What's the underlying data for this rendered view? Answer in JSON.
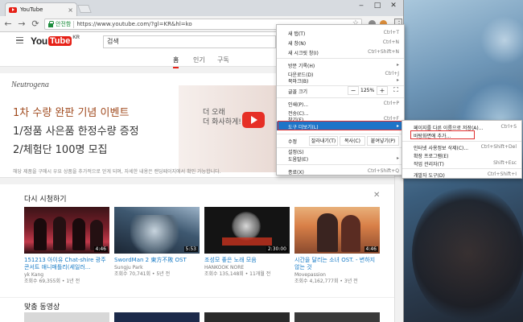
{
  "tab": {
    "title": "YouTube",
    "close": "×"
  },
  "window": {
    "minimize": "‒",
    "restore": "□",
    "close": "✕"
  },
  "toolbar": {
    "back": "←",
    "forward": "→",
    "reload": "⟳",
    "secure_label": "안전함",
    "url": "https://www.youtube.com/?gl=KR&hl=ko",
    "star": "☆",
    "menu": "⋮"
  },
  "yt": {
    "logo_you": "You",
    "logo_tube": "Tube",
    "logo_region": "KR",
    "search_text": "검색",
    "nav_tabs": [
      "홈",
      "인기",
      "구독"
    ]
  },
  "banner": {
    "brand": "Neutrogena",
    "line1": "1차 수량 완판 기념 이벤트",
    "line2": "1/정품 사은품 한정수량 증정",
    "line3": "2/체험단 100명 모집",
    "tag1": "더 오래",
    "tag2": "더 화사하게!",
    "disclaimer": "해당 제품을 구매시 우요 상품을 추가적으로 얻게 되며, 자세한 내용은 랜딩페이지에서 확인 가능합니다."
  },
  "shelf": {
    "title": "다시 시청하기",
    "close": "✕",
    "videos": [
      {
        "duration": "4:46",
        "title": "151213 아이유 Chat-shire 광주콘서트 애니매틀리(세일러...",
        "channel": "yk Kang",
        "meta": "조회수 69,355회 • 1년 전"
      },
      {
        "duration": "5:53",
        "title": "SwordMan 2 東方不敗 OST",
        "channel": "Sungju Park",
        "meta": "조회수 70,741회 • 5년 전"
      },
      {
        "duration": "2:30:00",
        "title": "조성모 좋은 노래 모음",
        "channel": "HANKOOK NORE",
        "meta": "조회수 135,148회 • 11개월 전"
      },
      {
        "duration": "4:46",
        "title": "시간을 달리는 소녀 OST. - 변하지 않는 것",
        "channel": "Movepassion",
        "meta": "조회수 4,162,777회 • 3년 전"
      }
    ]
  },
  "next_shelf": {
    "title": "맞춤 동영상"
  },
  "chrome_menu": {
    "items": [
      {
        "label": "새 탭(T)",
        "shortcut": "Ctrl+T"
      },
      {
        "label": "새 창(N)",
        "shortcut": "Ctrl+N"
      },
      {
        "label": "새 시크릿 창(I)",
        "shortcut": "Ctrl+Shift+N"
      },
      {
        "label": "방문 기록(H)",
        "shortcut": "▸"
      },
      {
        "label": "다운로드(D)",
        "shortcut": "Ctrl+J"
      },
      {
        "label": "북마크(B)",
        "shortcut": "▸"
      },
      {
        "label": "인쇄(P)...",
        "shortcut": "Ctrl+P"
      },
      {
        "label": "전송(C)...",
        "shortcut": ""
      },
      {
        "label": "찾기(F)...",
        "shortcut": "Ctrl+F"
      },
      {
        "label": "도구 더보기(L)",
        "shortcut": "▸"
      },
      {
        "label": "설정(S)",
        "shortcut": ""
      },
      {
        "label": "도움말(E)",
        "shortcut": "▸"
      },
      {
        "label": "종료(X)",
        "shortcut": "Ctrl+Shift+Q"
      }
    ],
    "zoom": {
      "label": "글꼴 크기",
      "minus": "−",
      "value": "125%",
      "plus": "+",
      "fullscreen": "⛶"
    },
    "edit": {
      "label": "수정",
      "cut": "잘라내기(T)",
      "copy": "복사(C)",
      "paste": "붙여넣기(P)"
    }
  },
  "submenu": {
    "items": [
      {
        "label": "페이지를 다른 이름으로 저장(A)...",
        "shortcut": "Ctrl+S"
      },
      {
        "label": "바탕화면에 추가...",
        "shortcut": ""
      },
      {
        "label": "인터넷 사용정보 삭제(C)...",
        "shortcut": "Ctrl+Shift+Del"
      },
      {
        "label": "확장 프로그램(E)",
        "shortcut": ""
      },
      {
        "label": "작업 관리자(T)",
        "shortcut": "Shift+Esc"
      },
      {
        "label": "개발자 도구(D)",
        "shortcut": "Ctrl+Shift+I"
      }
    ]
  },
  "colors": {
    "accent": "#e62117",
    "highlight": "#1e74c8",
    "outline": "#e03030",
    "link": "#167ac6"
  }
}
